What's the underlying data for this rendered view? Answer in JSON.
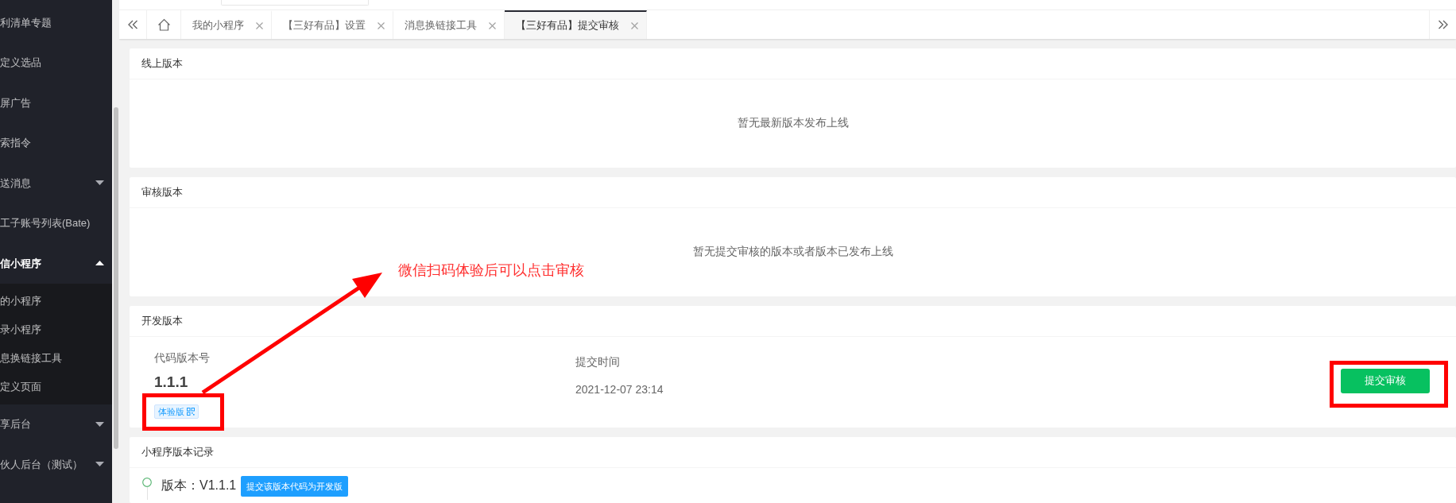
{
  "sidebar": {
    "items": [
      {
        "kind": "link",
        "label": "利清单专题"
      },
      {
        "kind": "link",
        "label": "定义选品"
      },
      {
        "kind": "link",
        "label": "屏广告"
      },
      {
        "kind": "link",
        "label": "索指令"
      },
      {
        "kind": "group",
        "label": "送消息",
        "expanded": false
      },
      {
        "kind": "link",
        "label": "工子账号列表(Bate)"
      },
      {
        "kind": "group",
        "label": "信小程序",
        "expanded": true,
        "children": [
          {
            "label": "的小程序"
          },
          {
            "label": "录小程序"
          },
          {
            "label": "息换链接工具"
          },
          {
            "label": "定义页面"
          }
        ]
      },
      {
        "kind": "group",
        "label": "享后台",
        "expanded": false
      },
      {
        "kind": "group",
        "label": "伙人后台（测试）",
        "expanded": false
      }
    ]
  },
  "tabs": {
    "items": [
      {
        "label": "我的小程序",
        "selected": false
      },
      {
        "label": "【三好有品】设置",
        "selected": false
      },
      {
        "label": "消息换链接工具",
        "selected": false
      },
      {
        "label": "【三好有品】提交审核",
        "selected": true
      }
    ]
  },
  "sections": [
    {
      "kind": "notice",
      "title": "线上版本",
      "message": "暂无最新版本发布上线"
    },
    {
      "kind": "notice",
      "title": "审核版本",
      "message": "暂无提交审核的版本或者版本已发布上线"
    },
    {
      "kind": "dev",
      "title": "开发版本",
      "code_version_label": "代码版本号",
      "code_version": "1.1.1",
      "badge": "体验版",
      "submit_time_label": "提交时间",
      "submit_time": "2021-12-07 23:14",
      "action": "提交审核"
    },
    {
      "kind": "history",
      "title": "小程序版本记录",
      "entries": [
        {
          "version": "版本：V1.1.1",
          "action": "提交该版本代码为开发版"
        }
      ]
    }
  ],
  "annotation": {
    "note": "微信扫码体验后可以点击审核"
  }
}
